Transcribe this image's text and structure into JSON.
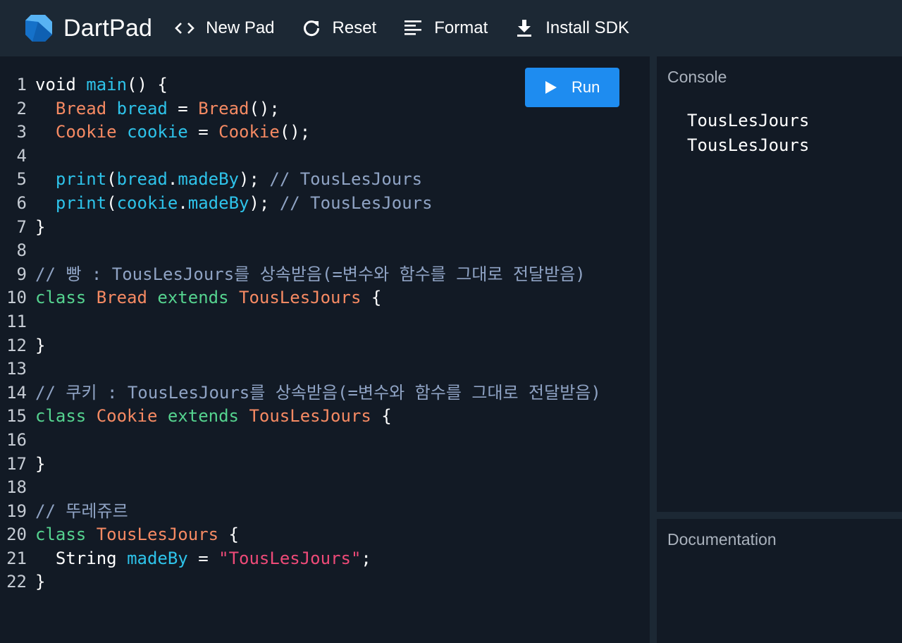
{
  "app": {
    "title": "DartPad"
  },
  "toolbar": {
    "new_pad": "New Pad",
    "reset": "Reset",
    "format": "Format",
    "install_sdk": "Install SDK"
  },
  "editor": {
    "run_label": "Run",
    "lines": [
      [
        {
          "t": "void ",
          "c": "kw"
        },
        {
          "t": "main",
          "c": "fn"
        },
        {
          "t": "() {",
          "c": "plain"
        }
      ],
      [
        {
          "t": "  ",
          "c": "plain"
        },
        {
          "t": "Bread",
          "c": "type"
        },
        {
          "t": " ",
          "c": "plain"
        },
        {
          "t": "bread",
          "c": "var"
        },
        {
          "t": " = ",
          "c": "plain"
        },
        {
          "t": "Bread",
          "c": "type"
        },
        {
          "t": "();",
          "c": "plain"
        }
      ],
      [
        {
          "t": "  ",
          "c": "plain"
        },
        {
          "t": "Cookie",
          "c": "type"
        },
        {
          "t": " ",
          "c": "plain"
        },
        {
          "t": "cookie",
          "c": "var"
        },
        {
          "t": " = ",
          "c": "plain"
        },
        {
          "t": "Cookie",
          "c": "type"
        },
        {
          "t": "();",
          "c": "plain"
        }
      ],
      [],
      [
        {
          "t": "  ",
          "c": "plain"
        },
        {
          "t": "print",
          "c": "fn"
        },
        {
          "t": "(",
          "c": "plain"
        },
        {
          "t": "bread",
          "c": "var"
        },
        {
          "t": ".",
          "c": "plain"
        },
        {
          "t": "madeBy",
          "c": "var"
        },
        {
          "t": "); ",
          "c": "plain"
        },
        {
          "t": "// TousLesJours",
          "c": "cm"
        }
      ],
      [
        {
          "t": "  ",
          "c": "plain"
        },
        {
          "t": "print",
          "c": "fn"
        },
        {
          "t": "(",
          "c": "plain"
        },
        {
          "t": "cookie",
          "c": "var"
        },
        {
          "t": ".",
          "c": "plain"
        },
        {
          "t": "madeBy",
          "c": "var"
        },
        {
          "t": "); ",
          "c": "plain"
        },
        {
          "t": "// TousLesJours",
          "c": "cm"
        }
      ],
      [
        {
          "t": "}",
          "c": "plain"
        }
      ],
      [],
      [
        {
          "t": "// 빵 : TousLesJours를 상속받음(=변수와 함수를 그대로 전달받음)",
          "c": "cm"
        }
      ],
      [
        {
          "t": "class ",
          "c": "cls"
        },
        {
          "t": "Bread",
          "c": "type"
        },
        {
          "t": " ",
          "c": "plain"
        },
        {
          "t": "extends ",
          "c": "cls"
        },
        {
          "t": "TousLesJours",
          "c": "type"
        },
        {
          "t": " {",
          "c": "plain"
        }
      ],
      [],
      [
        {
          "t": "}",
          "c": "plain"
        }
      ],
      [],
      [
        {
          "t": "// 쿠키 : TousLesJours를 상속받음(=변수와 함수를 그대로 전달받음)",
          "c": "cm"
        }
      ],
      [
        {
          "t": "class ",
          "c": "cls"
        },
        {
          "t": "Cookie",
          "c": "type"
        },
        {
          "t": " ",
          "c": "plain"
        },
        {
          "t": "extends ",
          "c": "cls"
        },
        {
          "t": "TousLesJours",
          "c": "type"
        },
        {
          "t": " {",
          "c": "plain"
        }
      ],
      [],
      [
        {
          "t": "}",
          "c": "plain"
        }
      ],
      [],
      [
        {
          "t": "// 뚜레쥬르",
          "c": "cm"
        }
      ],
      [
        {
          "t": "class ",
          "c": "cls"
        },
        {
          "t": "TousLesJours",
          "c": "type"
        },
        {
          "t": " {",
          "c": "plain"
        }
      ],
      [
        {
          "t": "  ",
          "c": "plain"
        },
        {
          "t": "String",
          "c": "kw"
        },
        {
          "t": " ",
          "c": "plain"
        },
        {
          "t": "madeBy",
          "c": "var"
        },
        {
          "t": " = ",
          "c": "plain"
        },
        {
          "t": "\"TousLesJours\"",
          "c": "str"
        },
        {
          "t": ";",
          "c": "plain"
        }
      ],
      [
        {
          "t": "}",
          "c": "plain"
        }
      ]
    ]
  },
  "console": {
    "title": "Console",
    "output": [
      "TousLesJours",
      "TousLesJours"
    ]
  },
  "docs": {
    "title": "Documentation"
  },
  "colors": {
    "topbar": "#1c2834",
    "background": "#121a25",
    "run_button": "#1e8cf0",
    "type": "#f68a63",
    "identifier": "#2ec3ea",
    "comment": "#8fa3c4",
    "keyword_class": "#55d38f",
    "string": "#ee4a78"
  }
}
